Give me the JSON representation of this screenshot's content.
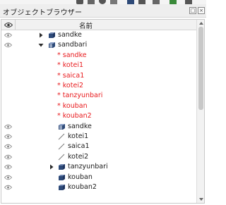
{
  "window": {
    "title": "オブジェクトブラウザー"
  },
  "tree": {
    "column_header": "名前",
    "rows": [
      {
        "label": "sandke",
        "level": 0,
        "icon": "solid-icon",
        "expander": "collapsed",
        "visibility": "visible",
        "error": false
      },
      {
        "label": "sandbari",
        "level": 0,
        "icon": "solid-grid-icon",
        "expander": "expanded",
        "visibility": "visible",
        "error": false
      },
      {
        "label": "* sandke",
        "level": 1,
        "icon": "",
        "expander": "none",
        "visibility": "none",
        "error": true
      },
      {
        "label": "* kotei1",
        "level": 1,
        "icon": "",
        "expander": "none",
        "visibility": "none",
        "error": true
      },
      {
        "label": "* saica1",
        "level": 1,
        "icon": "",
        "expander": "none",
        "visibility": "none",
        "error": true
      },
      {
        "label": "* kotei2",
        "level": 1,
        "icon": "",
        "expander": "none",
        "visibility": "none",
        "error": true
      },
      {
        "label": "* tanzyunbari",
        "level": 1,
        "icon": "",
        "expander": "none",
        "visibility": "none",
        "error": true
      },
      {
        "label": "* kouban",
        "level": 1,
        "icon": "",
        "expander": "none",
        "visibility": "none",
        "error": true
      },
      {
        "label": "* kouban2",
        "level": 1,
        "icon": "",
        "expander": "none",
        "visibility": "none",
        "error": true
      },
      {
        "label": "sandke",
        "level": 0,
        "icon": "solid-grid-icon",
        "expander": "none",
        "visibility": "visible",
        "error": false
      },
      {
        "label": "kotei1",
        "level": 0,
        "icon": "line-icon",
        "expander": "none",
        "visibility": "visible",
        "error": false
      },
      {
        "label": "saica1",
        "level": 0,
        "icon": "line-icon",
        "expander": "none",
        "visibility": "visible",
        "error": false
      },
      {
        "label": "kotei2",
        "level": 0,
        "icon": "line-icon",
        "expander": "none",
        "visibility": "visible",
        "error": false
      },
      {
        "label": "tanzyunbari",
        "level": 0,
        "icon": "solid-icon",
        "expander": "collapsed",
        "visibility": "visible",
        "error": false
      },
      {
        "label": "kouban",
        "level": 0,
        "icon": "solid-icon",
        "expander": "none",
        "visibility": "visible",
        "error": false
      },
      {
        "label": "kouban2",
        "level": 0,
        "icon": "solid-icon",
        "expander": "none",
        "visibility": "visible",
        "error": false
      }
    ]
  },
  "colors": {
    "error_text": "#e8191c",
    "solid_icon": "#2e4a78",
    "header_bg": "#f1f1f1"
  }
}
